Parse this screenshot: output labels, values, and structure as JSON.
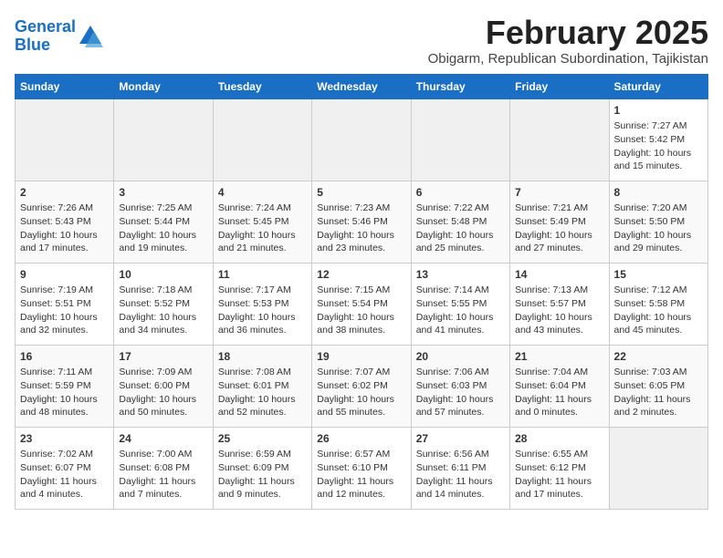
{
  "header": {
    "logo_line1": "General",
    "logo_line2": "Blue",
    "title": "February 2025",
    "subtitle": "Obigarm, Republican Subordination, Tajikistan"
  },
  "days_of_week": [
    "Sunday",
    "Monday",
    "Tuesday",
    "Wednesday",
    "Thursday",
    "Friday",
    "Saturday"
  ],
  "weeks": [
    [
      {
        "day": "",
        "info": ""
      },
      {
        "day": "",
        "info": ""
      },
      {
        "day": "",
        "info": ""
      },
      {
        "day": "",
        "info": ""
      },
      {
        "day": "",
        "info": ""
      },
      {
        "day": "",
        "info": ""
      },
      {
        "day": "1",
        "info": "Sunrise: 7:27 AM\nSunset: 5:42 PM\nDaylight: 10 hours and 15 minutes."
      }
    ],
    [
      {
        "day": "2",
        "info": "Sunrise: 7:26 AM\nSunset: 5:43 PM\nDaylight: 10 hours and 17 minutes."
      },
      {
        "day": "3",
        "info": "Sunrise: 7:25 AM\nSunset: 5:44 PM\nDaylight: 10 hours and 19 minutes."
      },
      {
        "day": "4",
        "info": "Sunrise: 7:24 AM\nSunset: 5:45 PM\nDaylight: 10 hours and 21 minutes."
      },
      {
        "day": "5",
        "info": "Sunrise: 7:23 AM\nSunset: 5:46 PM\nDaylight: 10 hours and 23 minutes."
      },
      {
        "day": "6",
        "info": "Sunrise: 7:22 AM\nSunset: 5:48 PM\nDaylight: 10 hours and 25 minutes."
      },
      {
        "day": "7",
        "info": "Sunrise: 7:21 AM\nSunset: 5:49 PM\nDaylight: 10 hours and 27 minutes."
      },
      {
        "day": "8",
        "info": "Sunrise: 7:20 AM\nSunset: 5:50 PM\nDaylight: 10 hours and 29 minutes."
      }
    ],
    [
      {
        "day": "9",
        "info": "Sunrise: 7:19 AM\nSunset: 5:51 PM\nDaylight: 10 hours and 32 minutes."
      },
      {
        "day": "10",
        "info": "Sunrise: 7:18 AM\nSunset: 5:52 PM\nDaylight: 10 hours and 34 minutes."
      },
      {
        "day": "11",
        "info": "Sunrise: 7:17 AM\nSunset: 5:53 PM\nDaylight: 10 hours and 36 minutes."
      },
      {
        "day": "12",
        "info": "Sunrise: 7:15 AM\nSunset: 5:54 PM\nDaylight: 10 hours and 38 minutes."
      },
      {
        "day": "13",
        "info": "Sunrise: 7:14 AM\nSunset: 5:55 PM\nDaylight: 10 hours and 41 minutes."
      },
      {
        "day": "14",
        "info": "Sunrise: 7:13 AM\nSunset: 5:57 PM\nDaylight: 10 hours and 43 minutes."
      },
      {
        "day": "15",
        "info": "Sunrise: 7:12 AM\nSunset: 5:58 PM\nDaylight: 10 hours and 45 minutes."
      }
    ],
    [
      {
        "day": "16",
        "info": "Sunrise: 7:11 AM\nSunset: 5:59 PM\nDaylight: 10 hours and 48 minutes."
      },
      {
        "day": "17",
        "info": "Sunrise: 7:09 AM\nSunset: 6:00 PM\nDaylight: 10 hours and 50 minutes."
      },
      {
        "day": "18",
        "info": "Sunrise: 7:08 AM\nSunset: 6:01 PM\nDaylight: 10 hours and 52 minutes."
      },
      {
        "day": "19",
        "info": "Sunrise: 7:07 AM\nSunset: 6:02 PM\nDaylight: 10 hours and 55 minutes."
      },
      {
        "day": "20",
        "info": "Sunrise: 7:06 AM\nSunset: 6:03 PM\nDaylight: 10 hours and 57 minutes."
      },
      {
        "day": "21",
        "info": "Sunrise: 7:04 AM\nSunset: 6:04 PM\nDaylight: 11 hours and 0 minutes."
      },
      {
        "day": "22",
        "info": "Sunrise: 7:03 AM\nSunset: 6:05 PM\nDaylight: 11 hours and 2 minutes."
      }
    ],
    [
      {
        "day": "23",
        "info": "Sunrise: 7:02 AM\nSunset: 6:07 PM\nDaylight: 11 hours and 4 minutes."
      },
      {
        "day": "24",
        "info": "Sunrise: 7:00 AM\nSunset: 6:08 PM\nDaylight: 11 hours and 7 minutes."
      },
      {
        "day": "25",
        "info": "Sunrise: 6:59 AM\nSunset: 6:09 PM\nDaylight: 11 hours and 9 minutes."
      },
      {
        "day": "26",
        "info": "Sunrise: 6:57 AM\nSunset: 6:10 PM\nDaylight: 11 hours and 12 minutes."
      },
      {
        "day": "27",
        "info": "Sunrise: 6:56 AM\nSunset: 6:11 PM\nDaylight: 11 hours and 14 minutes."
      },
      {
        "day": "28",
        "info": "Sunrise: 6:55 AM\nSunset: 6:12 PM\nDaylight: 11 hours and 17 minutes."
      },
      {
        "day": "",
        "info": ""
      }
    ]
  ]
}
